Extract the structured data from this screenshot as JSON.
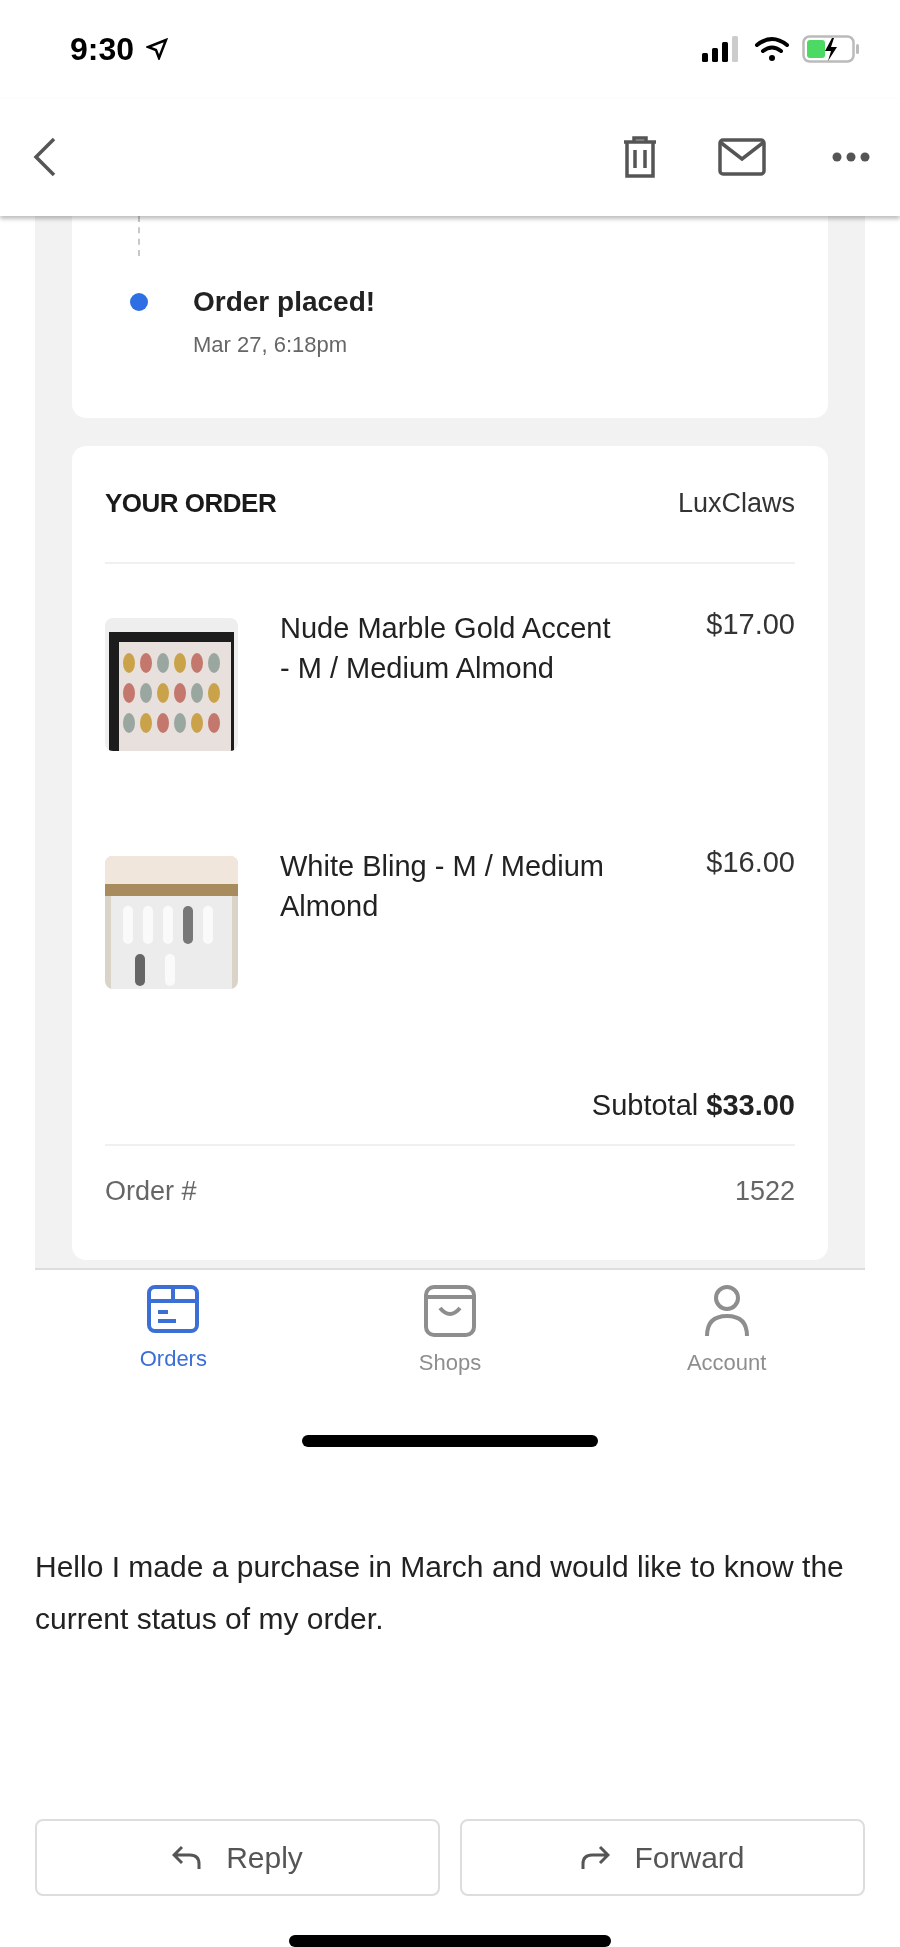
{
  "status_bar": {
    "time": "9:30"
  },
  "embedded_screenshot": {
    "timeline": [
      {
        "title": "Order placed!",
        "date": "Mar 27, 6:18pm"
      }
    ],
    "order": {
      "heading": "YOUR ORDER",
      "shop": "LuxClaws",
      "items": [
        {
          "name": "Nude Marble Gold Accent - M / Medium Almond",
          "price": "$17.00"
        },
        {
          "name": "White Bling - M / Medium Almond",
          "price": "$16.00"
        }
      ],
      "subtotal_label": "Subtotal",
      "subtotal": "$33.00",
      "order_number_label": "Order #",
      "order_number": "1522"
    },
    "tabs": [
      {
        "label": "Orders",
        "selected": true
      },
      {
        "label": "Shops",
        "selected": false
      },
      {
        "label": "Account",
        "selected": false
      }
    ]
  },
  "message": "Hello I made a purchase in March and would like to know the current status of my order.",
  "buttons": [
    {
      "label": "Reply"
    },
    {
      "label": "Forward"
    }
  ]
}
